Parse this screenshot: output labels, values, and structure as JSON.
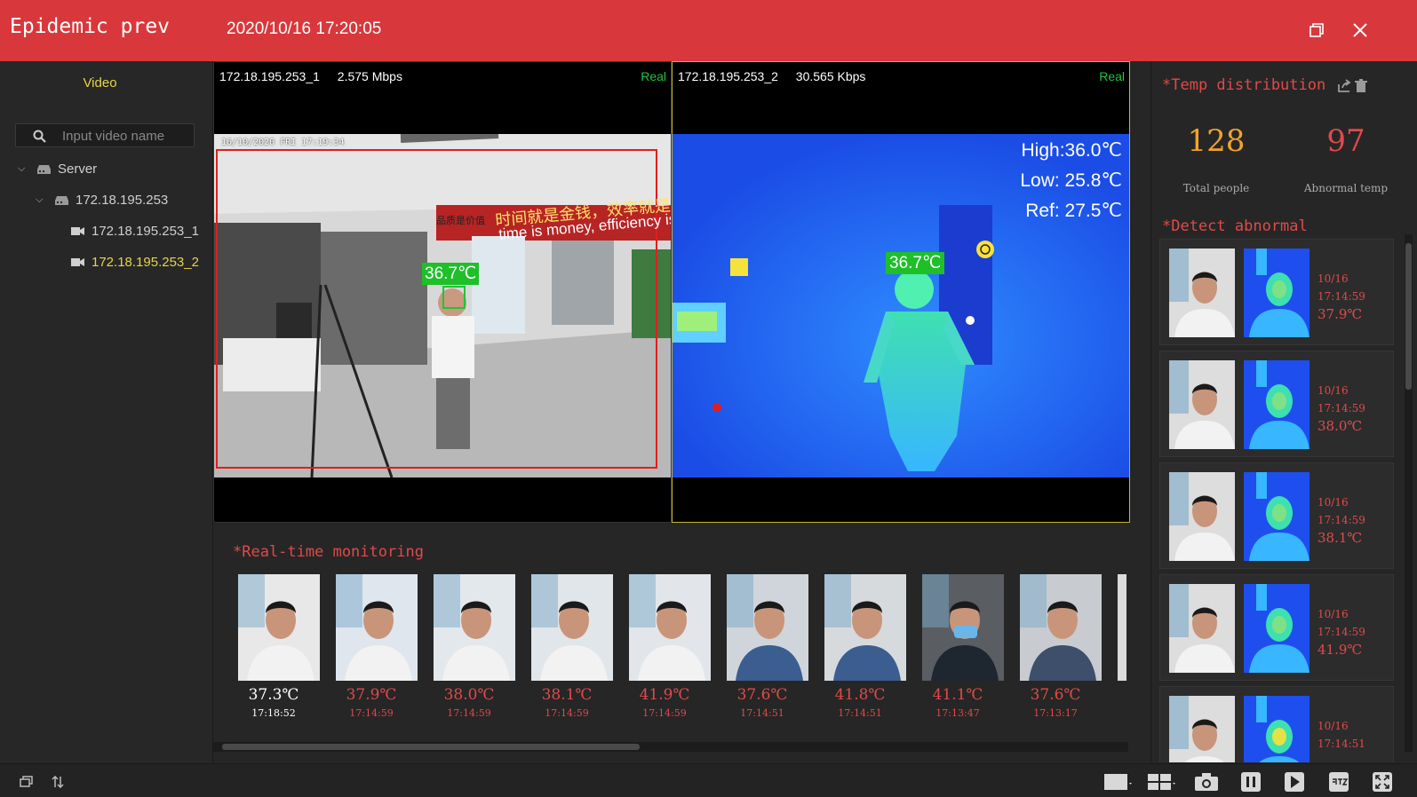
{
  "title": "Epidemic prev",
  "datetime": "2020/10/16 17:20:05",
  "sidebar": {
    "tab_label": "Video",
    "search_placeholder": "Input video name",
    "tree": {
      "server_label": "Server",
      "device_label": "172.18.195.253",
      "channels": [
        "172.18.195.253_1",
        "172.18.195.253_2"
      ]
    }
  },
  "video": {
    "left": {
      "name": "172.18.195.253_1",
      "bitrate": "2.575 Mbps",
      "mode": "Real",
      "osd_timestamp": "16/10/2020 FRI 17:19:34",
      "face_temp": "36.7℃",
      "banner_cn": "时间就是金钱，效率就是生",
      "banner_en": "time is money, efficiency is",
      "sign_cn": "品质是价值"
    },
    "right": {
      "name": "172.18.195.253_2",
      "bitrate": "30.565 Kbps",
      "mode": "Real",
      "high": "High:36.0℃",
      "low": "Low: 25.8℃",
      "ref": "Ref: 27.5℃",
      "person_temp": "36.7℃"
    }
  },
  "realtime": {
    "title": "*Real-time monitoring",
    "items": [
      {
        "temp": "37.3℃",
        "time": "17:18:52",
        "color": "#ffffff"
      },
      {
        "temp": "37.9℃",
        "time": "17:14:59",
        "color": "#e04a4a"
      },
      {
        "temp": "38.0℃",
        "time": "17:14:59",
        "color": "#e04a4a"
      },
      {
        "temp": "38.1℃",
        "time": "17:14:59",
        "color": "#e04a4a"
      },
      {
        "temp": "41.9℃",
        "time": "17:14:59",
        "color": "#e04a4a"
      },
      {
        "temp": "37.6℃",
        "time": "17:14:51",
        "color": "#e04a4a"
      },
      {
        "temp": "41.8℃",
        "time": "17:14:51",
        "color": "#e04a4a"
      },
      {
        "temp": "41.1℃",
        "time": "17:13:47",
        "color": "#e04a4a"
      },
      {
        "temp": "37.6℃",
        "time": "17:13:17",
        "color": "#e04a4a"
      }
    ]
  },
  "temp_distribution": {
    "title": "*Temp distribution",
    "total": "128",
    "total_label": "Total people",
    "abnormal": "97",
    "abnormal_label": "Abnormal temp",
    "total_color": "#f0a32c",
    "abnormal_color": "#e04a4a"
  },
  "detect_abnormal": {
    "title": "*Detect abnormal",
    "items": [
      {
        "date": "10/16",
        "time": "17:14:59",
        "temp": "37.9℃"
      },
      {
        "date": "10/16",
        "time": "17:14:59",
        "temp": "38.0℃"
      },
      {
        "date": "10/16",
        "time": "17:14:59",
        "temp": "38.1℃"
      },
      {
        "date": "10/16",
        "time": "17:14:59",
        "temp": "41.9℃"
      },
      {
        "date": "10/16",
        "time": "17:14:51",
        "temp": ""
      }
    ]
  },
  "colors": {
    "titlebar": "#d8383c",
    "accent_yellow": "#e7d44a",
    "alert_red": "#e04a4a",
    "live_green": "#22c33a"
  },
  "icons": [
    "restore-icon",
    "close-icon",
    "search-icon",
    "server-icon",
    "camera-icon",
    "export-icon",
    "trash-icon",
    "window-icon",
    "sort-icon",
    "layout-icon",
    "grid-icon",
    "snapshot-icon",
    "pause-icon",
    "play-icon",
    "ptz-icon",
    "fullscreen-icon"
  ]
}
